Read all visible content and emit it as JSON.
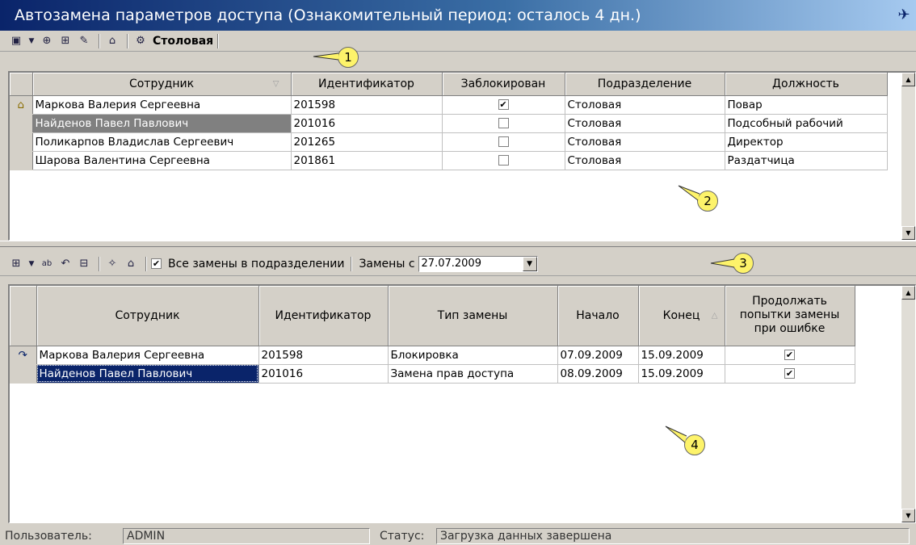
{
  "window": {
    "title": "Автозамена параметров доступа (Ознакомительный период: осталось 4 дн.)"
  },
  "top_toolbar": {
    "department": "Столовая"
  },
  "top_grid": {
    "columns": [
      "Сотрудник",
      "Идентификатор",
      "Заблокирован",
      "Подразделение",
      "Должность"
    ],
    "rows": [
      {
        "name": "Маркова Валерия Сергеевна",
        "id": "201598",
        "blocked": true,
        "department": "Столовая",
        "position": "Повар"
      },
      {
        "name": "Найденов Павел Павлович",
        "id": "201016",
        "blocked": false,
        "department": "Столовая",
        "position": "Подсобный рабочий"
      },
      {
        "name": "Поликарпов Владислав Сергеевич",
        "id": "201265",
        "blocked": false,
        "department": "Столовая",
        "position": "Директор"
      },
      {
        "name": "Шарова Валентина Сергеевна",
        "id": "201861",
        "blocked": false,
        "department": "Столовая",
        "position": "Раздатчица"
      }
    ]
  },
  "bottom_toolbar": {
    "all_in_department_label": "Все замены в подразделении",
    "all_in_department_checked": true,
    "replacements_from_label": "Замены с",
    "replacements_from_date": "27.07.2009"
  },
  "bottom_grid": {
    "columns": [
      "Сотрудник",
      "Идентификатор",
      "Тип замены",
      "Начало",
      "Конец",
      "Продолжать попытки замены при ошибке"
    ],
    "rows": [
      {
        "name": "Маркова Валерия Сергеевна",
        "id": "201598",
        "type": "Блокировка",
        "start": "07.09.2009",
        "end": "15.09.2009",
        "retry": true
      },
      {
        "name": "Найденов Павел Павлович",
        "id": "201016",
        "type": "Замена прав доступа",
        "start": "08.09.2009",
        "end": "15.09.2009",
        "retry": true
      }
    ]
  },
  "callouts": [
    "1",
    "2",
    "3",
    "4"
  ],
  "status_bar": {
    "user_label": "Пользователь:",
    "user_value": "ADMIN",
    "status_label": "Статус:",
    "status_value": "Загрузка данных завершена"
  },
  "icons": [
    "window-icon",
    "filter-icon",
    "dropdown-arrow-icon",
    "find-icon",
    "find-next-icon",
    "edit-icon",
    "properties-icon",
    "settings-icon",
    "add-icon",
    "rename-icon",
    "undo-icon",
    "delete-icon",
    "key-icon",
    "row-current-icon",
    "row-link-icon"
  ],
  "colors": {
    "title_start": "#0a246a",
    "selection_blue": "#0a246a",
    "selection_gray": "#808080",
    "callout_fill": "#fdf36a"
  }
}
